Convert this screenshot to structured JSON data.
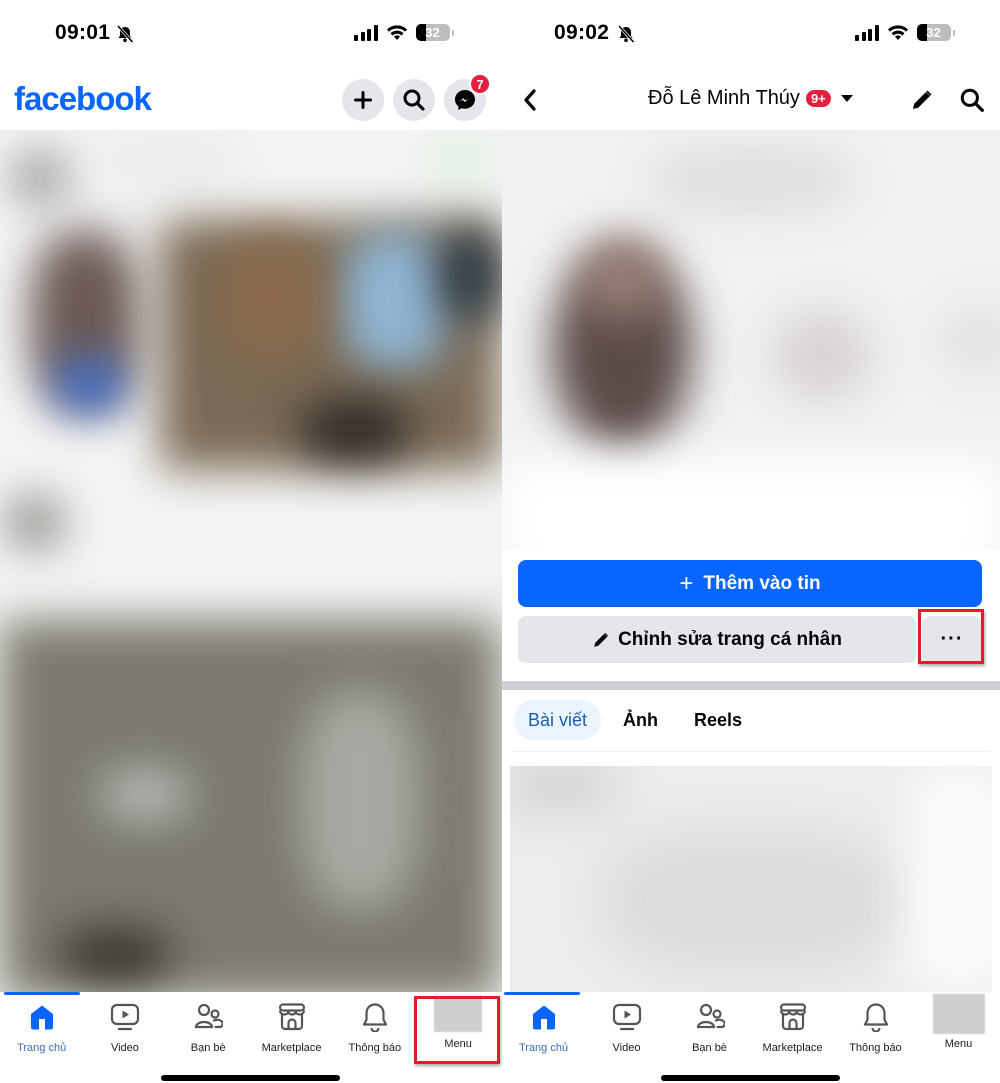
{
  "left_screen": {
    "status_bar": {
      "time": "09:01",
      "battery": "32",
      "battery_level_percent": 32
    },
    "header": {
      "logo": "facebook",
      "buttons": [
        {
          "name": "create",
          "icon": "plus-icon"
        },
        {
          "name": "search",
          "icon": "search-icon"
        },
        {
          "name": "messenger",
          "icon": "messenger-icon",
          "badge": "7"
        }
      ]
    },
    "feed": {
      "content": "blurred"
    },
    "bottom_nav": {
      "items": [
        {
          "label": "Trang chủ",
          "icon": "home-icon",
          "active": true
        },
        {
          "label": "Video",
          "icon": "video-icon"
        },
        {
          "label": "Bạn bè",
          "icon": "friends-icon"
        },
        {
          "label": "Marketplace",
          "icon": "marketplace-icon"
        },
        {
          "label": "Thông báo",
          "icon": "bell-icon"
        },
        {
          "label": "Menu",
          "icon": "profile-avatar",
          "highlighted": true
        }
      ]
    }
  },
  "right_screen": {
    "status_bar": {
      "time": "09:02",
      "battery": "32",
      "battery_level_percent": 32
    },
    "header": {
      "back_icon": "chevron-left-icon",
      "profile_name": "Đỗ Lê Minh Thúy",
      "notification_badge": "9+",
      "dropdown_icon": "caret-down-icon",
      "edit_icon": "pencil-icon",
      "search_icon": "search-icon"
    },
    "actions": {
      "add_story_label": "Thêm vào tin",
      "add_story_icon": "+",
      "edit_profile_label": "Chỉnh sửa trang cá nhân",
      "more_label": "···",
      "more_highlighted": true
    },
    "tabs": [
      {
        "label": "Bài viết",
        "active": true
      },
      {
        "label": "Ảnh"
      },
      {
        "label": "Reels"
      }
    ],
    "bottom_nav": {
      "items": [
        {
          "label": "Trang chủ",
          "icon": "home-icon",
          "active": true
        },
        {
          "label": "Video",
          "icon": "video-icon"
        },
        {
          "label": "Bạn bè",
          "icon": "friends-icon"
        },
        {
          "label": "Marketplace",
          "icon": "marketplace-icon"
        },
        {
          "label": "Thông báo",
          "icon": "bell-icon"
        },
        {
          "label": "Menu",
          "icon": "profile-avatar"
        }
      ]
    }
  },
  "colors": {
    "brand_blue": "#0866ff",
    "badge_red": "#e41e3f",
    "highlight_red": "#e11d26",
    "button_gray": "#e4e6eb",
    "active_tab_bg": "#ebf5ff"
  }
}
